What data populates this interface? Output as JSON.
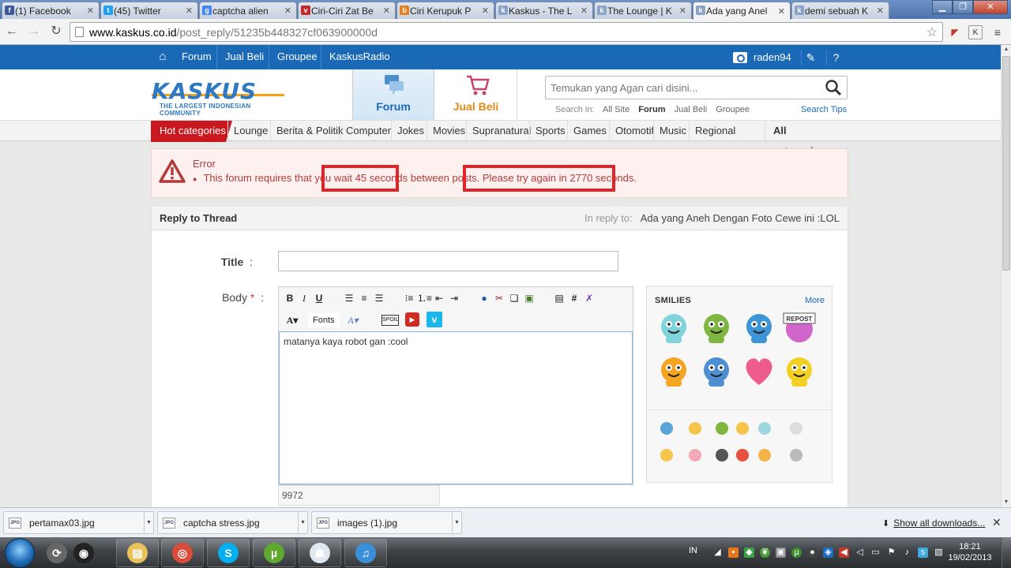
{
  "browser": {
    "tabs": [
      {
        "label": "(1) Facebook",
        "favicon": "facebook-icon",
        "color": "#3b5998",
        "glyph": "f"
      },
      {
        "label": "(45) Twitter",
        "favicon": "twitter-icon",
        "color": "#1da1f2",
        "glyph": "t"
      },
      {
        "label": "captcha alien",
        "favicon": "google-icon",
        "color": "#4285f4",
        "glyph": "g"
      },
      {
        "label": "Ciri-Ciri Zat Be",
        "favicon": "vivaldi-icon",
        "color": "#c62828",
        "glyph": "v"
      },
      {
        "label": "Ciri Kerupuk P",
        "favicon": "blogger-icon",
        "color": "#e67e22",
        "glyph": "b"
      },
      {
        "label": "Kaskus - The L",
        "favicon": "kaskus-icon",
        "color": "#8aa4c8",
        "glyph": "k"
      },
      {
        "label": "The Lounge | K",
        "favicon": "kaskus-icon",
        "color": "#8aa4c8",
        "glyph": "k"
      },
      {
        "label": "Ada yang Anel",
        "favicon": "kaskus-icon",
        "color": "#8aa4c8",
        "glyph": "k",
        "active": true
      },
      {
        "label": "demi sebuah K",
        "favicon": "kaskus-icon",
        "color": "#8aa4c8",
        "glyph": "k"
      }
    ],
    "url_host": "www.kaskus.co.id",
    "url_path": "/post_reply/51235b448327cf063900000d"
  },
  "topbar": {
    "nav": [
      "Forum",
      "Jual Beli",
      "Groupee",
      "KaskusRadio"
    ],
    "username": "raden94",
    "color": "#1a69b6"
  },
  "header": {
    "logo_word": "KASKUS",
    "logo_tagline": "THE LARGEST INDONESIAN COMMUNITY",
    "tab_forum": "Forum",
    "tab_jualbeli": "Jual Beli",
    "search_placeholder": "Temukan yang Agan cari disini...",
    "search_in_label": "Search in:",
    "search_in_options": [
      "All Site",
      "Forum",
      "Jual Beli",
      "Groupee"
    ],
    "search_in_active": "Forum",
    "search_tips": "Search Tips"
  },
  "categories": {
    "hot": "Hot categories",
    "items": [
      "Lounge",
      "Berita & Politik",
      "Computer",
      "Jokes",
      "Movies",
      "Supranatural",
      "Sports",
      "Games",
      "Otomotif",
      "Music",
      "Regional"
    ],
    "all": "All categories",
    "hot_color": "#c9181f"
  },
  "error": {
    "title": "Error",
    "part1": "This forum requires that you ",
    "part2": "wait 45 seconds",
    "part3": " between posts. ",
    "part4": "Please try again in 2770 seconds.",
    "highlight_color": "#e22327"
  },
  "reply": {
    "heading": "Reply to Thread",
    "in_reply_label": "In reply to:",
    "thread_title": "Ada yang Aneh Dengan Foto Cewe ini :LOL",
    "title_label": "Title",
    "body_label": "Body",
    "colon": ":",
    "required": "*",
    "title_value": "",
    "body_value": "matanya kaya robot gan :cool",
    "char_count": "9972",
    "fonts_label": "Fonts",
    "toolbar": [
      "bold",
      "italic",
      "underline",
      "align-left",
      "align-center",
      "align-right",
      "bullet-list",
      "numbered-list",
      "outdent",
      "indent",
      "insert-link",
      "remove-link",
      "quote",
      "insert-image",
      "code",
      "hash",
      "spoiler-clear",
      "font-color",
      "font-size",
      "spoiler",
      "youtube",
      "vimeo"
    ],
    "spoil_label": "SPOIL"
  },
  "smilies": {
    "title": "SMILIES",
    "more": "More",
    "big": [
      {
        "name": "cendol-smiley",
        "color": "#7fd3db"
      },
      {
        "name": "watermelon-smiley",
        "color": "#7fb63f"
      },
      {
        "name": "blue-grin-smiley",
        "color": "#3d95d8"
      },
      {
        "name": "repost-smiley",
        "color": "#d066c9",
        "text": "REPOST"
      },
      {
        "name": "facepalm-smiley",
        "color": "#f4a622"
      },
      {
        "name": "blue-shock-smiley",
        "color": "#4e8fd3"
      },
      {
        "name": "heart-smiley",
        "color": "#ee5c8c"
      },
      {
        "name": "yellow-grin-smiley",
        "color": "#f2d024"
      }
    ],
    "small": [
      {
        "name": "small-cendol-smiley",
        "color": "#5aa4d6"
      },
      {
        "name": "small-smile-smiley",
        "color": "#f4c54a"
      },
      {
        "name": "small-alien-smiley",
        "color": "#7fb63f"
      },
      {
        "name": "small-wink-smiley",
        "color": "#f4c54a"
      },
      {
        "name": "small-cool-smiley",
        "color": "#9fd5dd"
      },
      {
        "name": "small-peace-smiley",
        "color": "#ddd"
      },
      {
        "name": "small-laugh-smiley",
        "color": "#f4c54a"
      },
      {
        "name": "small-pig-smiley",
        "color": "#f3a9b8"
      },
      {
        "name": "small-dark-smiley",
        "color": "#555"
      },
      {
        "name": "small-angry-smiley",
        "color": "#e85040"
      },
      {
        "name": "small-sad-smiley",
        "color": "#f4b44a"
      },
      {
        "name": "small-sign-smiley",
        "color": "#bbb"
      }
    ]
  },
  "downloads": {
    "items": [
      "pertamax03.jpg",
      "captcha stress.jpg",
      "images (1).jpg"
    ],
    "file_tag": "JPG",
    "show_all": "Show all downloads..."
  },
  "taskbar": {
    "lang": "IN",
    "time": "18:21",
    "date": "19/02/2013",
    "apps": [
      {
        "name": "taskbar-sync-icon",
        "glyph": "⟳",
        "color": "#666"
      },
      {
        "name": "taskbar-camera-icon",
        "glyph": "◉",
        "color": "#222"
      },
      {
        "name": "taskbar-explorer-icon",
        "glyph": "▤",
        "color": "#e8c15a"
      },
      {
        "name": "taskbar-chrome-icon",
        "glyph": "◎",
        "color": "#d94b3a"
      },
      {
        "name": "taskbar-skype-icon",
        "glyph": "S",
        "color": "#00aff0"
      },
      {
        "name": "taskbar-utorrent-icon",
        "glyph": "µ",
        "color": "#5fa92e"
      },
      {
        "name": "taskbar-cat-icon",
        "glyph": "☗",
        "color": "#dfe7ef"
      },
      {
        "name": "taskbar-itunes-icon",
        "glyph": "♫",
        "color": "#3b8fd9"
      }
    ]
  }
}
